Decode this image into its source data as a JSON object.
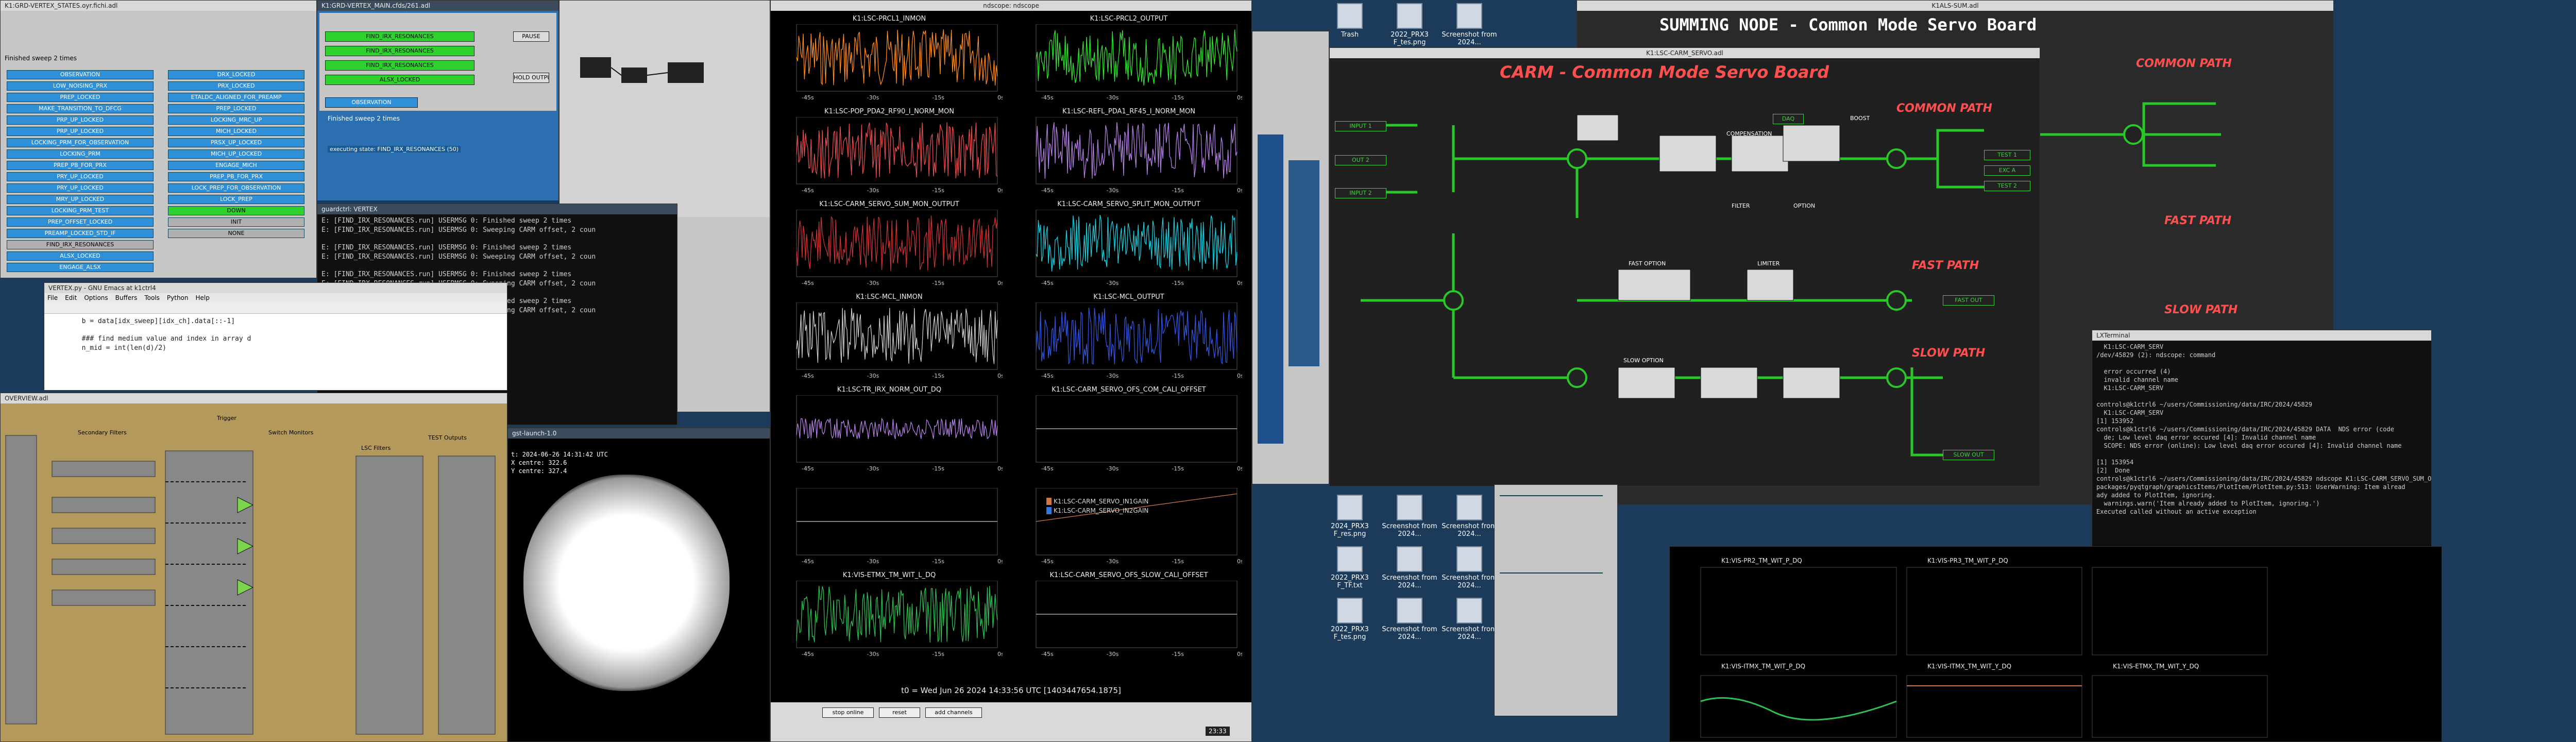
{
  "desktop": {
    "icons": [
      {
        "label": "Trash"
      },
      {
        "label": "2022_PRX3 F_tes.png"
      },
      {
        "label": "Screenshot from 2024..."
      },
      {
        "label": "2024_PRX3 F_res.png"
      },
      {
        "label": "Screenshot from 2024..."
      },
      {
        "label": "Screenshot from 2024..."
      },
      {
        "label": "2022_PRX3 F_TF.txt"
      },
      {
        "label": "Screenshot from 2024..."
      },
      {
        "label": "Screenshot from 2024..."
      },
      {
        "label": "2022_PRX3 F_tes.png"
      },
      {
        "label": "Screenshot from 2024..."
      },
      {
        "label": "Screenshot from 2024..."
      }
    ]
  },
  "vertex_states": {
    "title": "K1:GRD-VERTEX_STATES.oyr.fichi.adl",
    "left_items": [
      "OBSERVATION",
      "LOW_NOISING_PRX",
      "PREP_LOCKED",
      "MAKE_TRANSITION_TO_DFCG",
      "PRP_UP_LOCKED",
      "PRP_UP_LOCKED",
      "LOCKING_PRM_FOR_OBSERVATION",
      "LOCKING_PRM",
      "PREP_PB_FOR_PRX",
      "PRY_UP_LOCKED",
      "PRY_UP_LOCKED",
      "MRY_UP_LOCKED",
      "LOCKING_PRM_TEST",
      "PREP_OFFSET_LOCKED",
      "PREAMP_LOCKED_STD_IF",
      "FIND_IRX_RESONANCES",
      "ALSX_LOCKED",
      "ENGAGE_ALSX"
    ],
    "right_items": [
      "DRX_LOCKED",
      "PRX_LOCKED",
      "ETALDC_ALIGNED_FOR_PREAMP",
      "PREP_LOCKED",
      "LOCKING_MRC_UP",
      "MICH_LOCKED",
      "PRSX_UP_LOCKED",
      "MICH_UP_LOCKED",
      "ENGAGE_MICH",
      "PREP_PB_FOR_PRX",
      "LOCK_PREP_FOR_OBSERVATION",
      "LOCK_PREP",
      "DOWN",
      "INIT",
      "NONE"
    ],
    "status": "Finished sweep 2 times"
  },
  "vertex_main": {
    "title": "K1:GRD-VERTEX_MAIN.cfds/261.adl",
    "items": [
      "FIND_IRX_RESONANCES",
      "FIND_IRX_RESONANCES",
      "FIND_IRX_RESONANCES",
      "ALSX_LOCKED",
      "OBSERVATION"
    ],
    "status": "Finished sweep 2 times",
    "mode": "PAUSE",
    "hold": "HOLD OUTPUT",
    "state_note": "executing state: FIND_IRX_RESONANCES (50)"
  },
  "guardlog": {
    "title": "guardctrl: VERTEX",
    "lines": [
      "E: [FIND_IRX_RESONANCES.run] USERMSG 0: Finished sweep 2 times",
      "E: [FIND_IRX_RESONANCES.run] USERMSG 0: Sweeping CARM offset, 2 coun",
      "",
      "E: [FIND_IRX_RESONANCES.run] USERMSG 0: Finished sweep 2 times",
      "E: [FIND_IRX_RESONANCES.run] USERMSG 0: Sweeping CARM offset, 2 coun",
      "",
      "E: [FIND_IRX_RESONANCES.run] USERMSG 0: Finished sweep 2 times",
      "E: [FIND_IRX_RESONANCES.run] USERMSG 0: Sweeping CARM offset, 2 coun",
      "",
      "E: [FIND_IRX_RESONANCES.run] USERMSG 0: Finished sweep 2 times",
      "E: [FIND_IRX_RESONANCES.run] USERMSG 0: Sweeping CARM offset, 2 coun"
    ]
  },
  "emacs": {
    "title": "VERTEX.py - GNU Emacs at k1ctrl4",
    "menu": [
      "File",
      "Edit",
      "Options",
      "Buffers",
      "Tools",
      "Python",
      "Help"
    ],
    "code": [
      "        b = data[idx_sweep][idx_ch].data[::-1]",
      "",
      "        ### find medium value and index in array d",
      "        n_mid = int(len(d)/2)"
    ]
  },
  "overview": {
    "title": "OVERVIEW.adl",
    "sections": [
      "Secondary Filters",
      "Trigger",
      "Switch Monitors",
      "LSC Filters",
      "TEST Outputs"
    ]
  },
  "camera": {
    "title": "gst-launch-1.0",
    "info": [
      "t: 2024-06-26 14:31:42 UTC",
      "X centre: 322.6",
      "Y centre: 327.4"
    ]
  },
  "ndscope": {
    "title": "ndscope: ndscope",
    "plots": [
      {
        "title": "K1:LSC-PRCL1_INMON",
        "color": "#ff8c1a"
      },
      {
        "title": "K1:LSC-PRCL2_OUTPUT",
        "color": "#33e633"
      },
      {
        "title": "K1:LSC-POP_PDA2_RF90_I_NORM_MON",
        "color": "#e64d4d"
      },
      {
        "title": "K1:LSC-REFL_PDA1_RF45_I_NORM_MON",
        "color": "#b580e6"
      },
      {
        "title": "K1:LSC-CARM_SERVO_SUM_MON_OUTPUT",
        "color": "#cc3333"
      },
      {
        "title": "K1:LSC-CARM_SERVO_SPLIT_MON_OUTPUT",
        "color": "#1ad0e0"
      },
      {
        "title": "K1:LSC-MCL_INMON",
        "color": "#cccccc"
      },
      {
        "title": "K1:LSC-MCL_OUTPUT",
        "color": "#3355dd"
      },
      {
        "title": "K1:LSC-TR_IRX_NORM_OUT_DQ",
        "color": "#b580e6"
      },
      {
        "title": "K1:LSC-CARM_SERVO_OFS_COM_CALI_OFFSET",
        "color": "#cccccc"
      },
      {
        "title": "",
        "color": "#cccccc"
      },
      {
        "title": "",
        "color": "#cc7744"
      },
      {
        "title": "K1:VIS-ETMX_TM_WIT_L_DQ",
        "color": "#2fbf55"
      },
      {
        "title": "K1:LSC-CARM_SERVO_OFS_SLOW_CALI_OFFSET",
        "color": "#cccccc"
      }
    ],
    "legend": [
      "K1:LSC-CARM_SERVO_IN1GAIN",
      "K1:LSC-CARM_SERVO_IN2GAIN"
    ],
    "xticks": [
      "-45s",
      "-30s",
      "-15s",
      "0s"
    ],
    "t0": "t0 = Wed Jun 26 2024 14:33:56 UTC [1403447654.1875]",
    "buttons": [
      "stop online",
      "reset",
      "add channels"
    ]
  },
  "carm": {
    "title": "K1:LSC-CARM_SERVO.adl",
    "header": "CARM - Common Mode Servo Board",
    "sections": {
      "common": "COMMON PATH",
      "fast": "FAST PATH",
      "slow": "SLOW PATH"
    },
    "labels": [
      "INPUT 1",
      "OUT 2",
      "INPUT 2",
      "TEST 1",
      "EXC A",
      "TEST 2",
      "FAST OUT",
      "SLOW OUT",
      "DAQ",
      "BOOST",
      "COMPENSATION",
      "FILTER",
      "OPTION",
      "FAST OPTION",
      "LIMITER",
      "SLOW OPTION"
    ]
  },
  "summing": {
    "title": "K1ALS-SUM.adl",
    "header": "SUMMING NODE - Common Mode Servo Board"
  },
  "lxterm": {
    "title": "LXTerminal",
    "lines": [
      "  K1:LSC-CARM_SERV",
      "/dev/45829 (2): ndscope: command",
      "",
      "  error occurred (4)",
      "  invalid channel name",
      "  K1:LSC-CARM_SERV",
      "",
      "controls@k1ctrl6 ~/users/Commissioning/data/IRC/2024/45829",
      "  K1:LSC-CARM_SERV",
      "[1] 153952",
      "controls@k1ctrl6 ~/users/Commissioning/data/IRC/2024/45829 DATA  NDS error (code",
      "  de; Low level daq error occured [4]: Invalid channel name",
      "  SCOPE: NDS error (online): Low level daq error occured [4]: Invalid channel name",
      "",
      "[1] 153954",
      "[2]  Done",
      "controls@k1ctrl6 ~/users/Commissioning/data/IRC/2024/45829 ndscope K1:LSC-CARM_SERVO_SUM_OUTMON",
      "packages/pyqtgraph/graphicsItems/PlotItem/PlotItem.py:513: UserWarning: Item alread",
      "ady added to PlotItem, ignoring.",
      "  warnings.warn('Item already added to PlotItem, ignoring.')",
      "Executed called without an active exception"
    ]
  },
  "vis_plots": [
    {
      "title": "K1:VIS-PR2_TM_WIT_P_DQ"
    },
    {
      "title": "K1:VIS-PR3_TM_WIT_P_DQ"
    },
    {
      "title": "K1:VIS-ITMX_TM_WIT_P_DQ"
    },
    {
      "title": "K1:VIS-ITMX_TM_WIT_Y_DQ"
    },
    {
      "title": "K1:VIS-ETMX_TM_WIT_Y_DQ"
    }
  ],
  "taskbar": {
    "time": "23:33"
  }
}
